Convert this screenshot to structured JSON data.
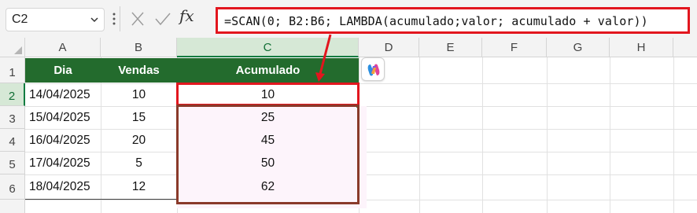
{
  "namebox": {
    "value": "C2"
  },
  "formula": {
    "text": "=SCAN(0; B2:B6; LAMBDA(acumulado;valor; acumulado + valor))"
  },
  "columns": [
    "A",
    "B",
    "C",
    "D",
    "E",
    "F",
    "G",
    "H"
  ],
  "rows": [
    "1",
    "2",
    "3",
    "4",
    "5",
    "6"
  ],
  "table": {
    "headers": {
      "dia": "Dia",
      "vendas": "Vendas",
      "acumulado": "Acumulado"
    },
    "records": [
      {
        "dia": "14/04/2025",
        "vendas": "10",
        "acumulado": "10"
      },
      {
        "dia": "15/04/2025",
        "vendas": "15",
        "acumulado": "25"
      },
      {
        "dia": "16/04/2025",
        "vendas": "20",
        "acumulado": "45"
      },
      {
        "dia": "17/04/2025",
        "vendas": "5",
        "acumulado": "50"
      },
      {
        "dia": "18/04/2025",
        "vendas": "12",
        "acumulado": "62"
      }
    ]
  },
  "icons": {
    "namebox_dropdown": "chevron-down-icon",
    "more": "vertical-dots-icon",
    "cancel": "x-icon",
    "enter": "check-icon",
    "function": "fx-icon",
    "copilot": "copilot-icon"
  },
  "colors": {
    "header_fill": "#236b2d",
    "highlight_red": "#e2161e",
    "highlight_brown": "#8a3a2a",
    "selection_green": "#107c41"
  }
}
